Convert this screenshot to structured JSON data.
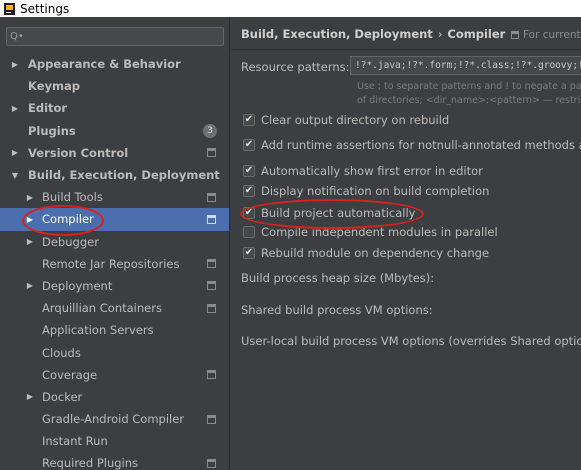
{
  "window": {
    "title": "Settings"
  },
  "sidebar": {
    "search_placeholder": "Q•",
    "items": [
      {
        "label": "Appearance & Behavior",
        "arrow": "▶"
      },
      {
        "label": "Keymap",
        "arrow": ""
      },
      {
        "label": "Editor",
        "arrow": "▶"
      },
      {
        "label": "Plugins",
        "arrow": "",
        "badge": "3"
      },
      {
        "label": "Version Control",
        "arrow": "▶"
      },
      {
        "label": "Build, Execution, Deployment",
        "arrow": "▼"
      },
      {
        "label": "Build Tools",
        "arrow": "▶"
      },
      {
        "label": "Compiler",
        "arrow": "▶"
      },
      {
        "label": "Debugger",
        "arrow": "▶"
      },
      {
        "label": "Remote Jar Repositories",
        "arrow": ""
      },
      {
        "label": "Deployment",
        "arrow": "▶"
      },
      {
        "label": "Arquillian Containers",
        "arrow": ""
      },
      {
        "label": "Application Servers",
        "arrow": ""
      },
      {
        "label": "Clouds",
        "arrow": ""
      },
      {
        "label": "Coverage",
        "arrow": ""
      },
      {
        "label": "Docker",
        "arrow": "▶"
      },
      {
        "label": "Gradle-Android Compiler",
        "arrow": ""
      },
      {
        "label": "Instant Run",
        "arrow": ""
      },
      {
        "label": "Required Plugins",
        "arrow": ""
      }
    ]
  },
  "main": {
    "breadcrumb": {
      "parent": "Build, Execution, Deployment",
      "separator": "›",
      "current": "Compiler"
    },
    "for_current": "For current",
    "resource_patterns": {
      "label": "Resource patterns:",
      "value": "!?*.java;!?*.form;!?*.class;!?*.groovy;!?*.scala;!?*.flex",
      "hint_line1": "Use ; to separate patterns and ! to negate a pattern.",
      "hint_line2": "of directories; <dir_name>:<pattern> — restrict to"
    },
    "options": [
      {
        "label": "Clear output directory on rebuild",
        "checked": true
      },
      {
        "label": "Add runtime assertions for notnull-annotated methods and parameters",
        "checked": true
      },
      {
        "label": "Automatically show first error in editor",
        "checked": true
      },
      {
        "label": "Display notification on build completion",
        "checked": true
      },
      {
        "label": "Build project automatically",
        "checked": true
      },
      {
        "label": "Compile independent modules in parallel",
        "checked": false
      },
      {
        "label": "Rebuild module on dependency change",
        "checked": true
      }
    ],
    "heap_size_label": "Build process heap size (Mbytes):",
    "shared_vm_label": "Shared build process VM options:",
    "user_vm_label": "User-local build process VM options (overrides Shared options):"
  },
  "colors": {
    "accent": "#4b6eaf",
    "annotation": "#d7221f",
    "background": "#3c3f41"
  },
  "icons": {
    "app": "intellij-app-icon",
    "project": "project-scope-icon",
    "check": "✔"
  }
}
